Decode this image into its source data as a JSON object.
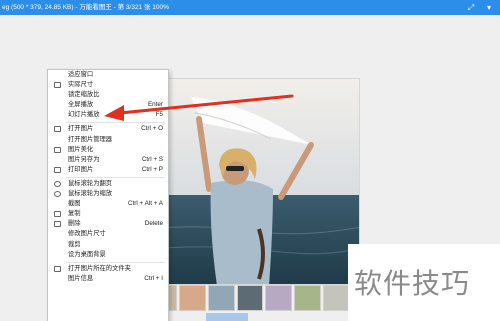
{
  "window": {
    "title": "eg (500 * 379, 24.85 KB) - 万能看图王 - 第 3/321 张 100%",
    "fullscreen_icon": "expand-icon",
    "menu_icon": "chevron-down-icon"
  },
  "context_menu": {
    "items": [
      {
        "label": "适应窗口",
        "shortcut": "",
        "icon": "none"
      },
      {
        "label": "实际尺寸",
        "shortcut": "",
        "icon": "actual-size-icon"
      },
      {
        "label": "锁定缩放比",
        "shortcut": "",
        "icon": "none"
      },
      {
        "label": "全屏播放",
        "shortcut": "Enter",
        "icon": "none"
      },
      {
        "label": "幻灯片播放",
        "shortcut": "F5",
        "icon": "none"
      },
      {
        "label": "打开图片",
        "shortcut": "Ctrl + O",
        "icon": "open-icon"
      },
      {
        "label": "打开图片管理器",
        "shortcut": "",
        "icon": "none"
      },
      {
        "label": "图片美化",
        "shortcut": "",
        "icon": "magic-wand-icon"
      },
      {
        "label": "图片另存为",
        "shortcut": "Ctrl + S",
        "icon": "none"
      },
      {
        "label": "打印图片",
        "shortcut": "Ctrl + P",
        "icon": "print-icon"
      },
      {
        "label": "鼠标滚轮为翻页",
        "shortcut": "",
        "icon": "radio-icon"
      },
      {
        "label": "鼠标滚轮为缩放",
        "shortcut": "",
        "icon": "radio-icon"
      },
      {
        "label": "截图",
        "shortcut": "Ctrl + Alt + A",
        "icon": "none"
      },
      {
        "label": "复制",
        "shortcut": "",
        "icon": "copy-icon"
      },
      {
        "label": "删除",
        "shortcut": "Delete",
        "icon": "delete-icon"
      },
      {
        "label": "修改图片尺寸",
        "shortcut": "",
        "icon": "none"
      },
      {
        "label": "裁剪",
        "shortcut": "",
        "icon": "none"
      },
      {
        "label": "设为桌面背景",
        "shortcut": "",
        "icon": "none"
      },
      {
        "label": "打开图片所在的文件夹",
        "shortcut": "",
        "icon": "folder-icon"
      },
      {
        "label": "图片信息",
        "shortcut": "Ctrl + I",
        "icon": "none"
      }
    ]
  },
  "watermark": {
    "text": "软件技巧"
  },
  "colors": {
    "titlebar": "#2d8ee9",
    "arrow": "#e0301e",
    "scroll_thumb": "#a9c7ea"
  }
}
